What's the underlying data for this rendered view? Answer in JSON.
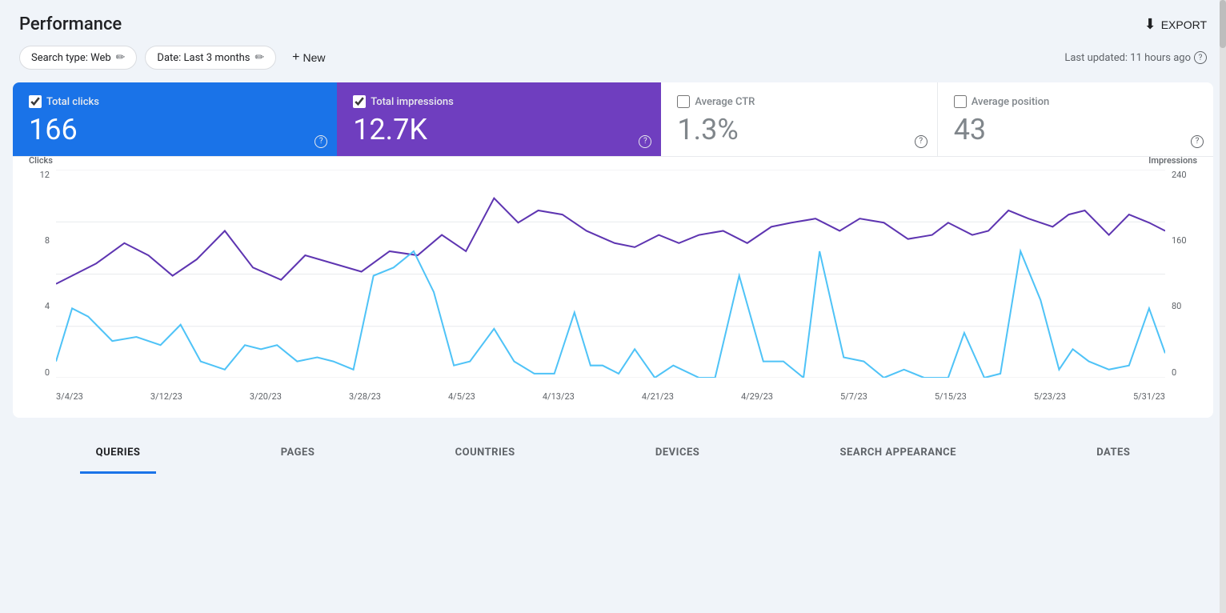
{
  "header": {
    "title": "Performance",
    "export_label": "EXPORT"
  },
  "filters": {
    "search_type_label": "Search type: Web",
    "date_label": "Date: Last 3 months",
    "new_label": "New",
    "last_updated": "Last updated: 11 hours ago"
  },
  "metrics": {
    "total_clicks": {
      "label": "Total clicks",
      "value": "166"
    },
    "total_impressions": {
      "label": "Total impressions",
      "value": "12.7K"
    },
    "avg_ctr": {
      "label": "Average CTR",
      "value": "1.3%"
    },
    "avg_position": {
      "label": "Average position",
      "value": "43"
    }
  },
  "chart": {
    "left_axis_label": "Clicks",
    "right_axis_label": "Impressions",
    "left_axis_values": [
      "12",
      "8",
      "4",
      "0"
    ],
    "right_axis_values": [
      "240",
      "160",
      "80",
      "0"
    ],
    "x_labels": [
      "3/4/23",
      "3/12/23",
      "3/20/23",
      "3/28/23",
      "4/5/23",
      "4/13/23",
      "4/21/23",
      "4/29/23",
      "5/7/23",
      "5/15/23",
      "5/23/23",
      "5/31/23"
    ]
  },
  "tabs": [
    {
      "label": "QUERIES",
      "active": true
    },
    {
      "label": "PAGES",
      "active": false
    },
    {
      "label": "COUNTRIES",
      "active": false
    },
    {
      "label": "DEVICES",
      "active": false
    },
    {
      "label": "SEARCH APPEARANCE",
      "active": false
    },
    {
      "label": "DATES",
      "active": false
    }
  ]
}
